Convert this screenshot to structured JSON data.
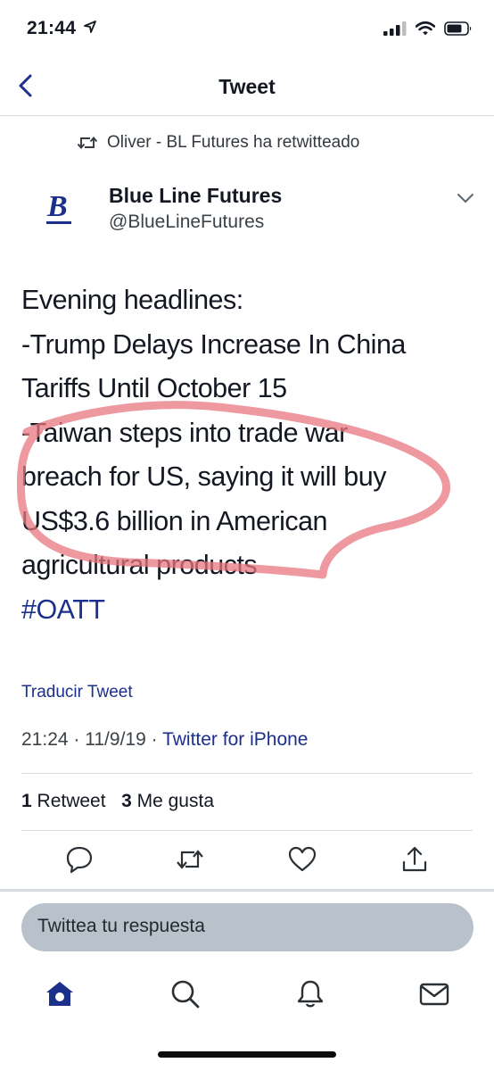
{
  "status_bar": {
    "time": "21:44"
  },
  "nav": {
    "title": "Tweet"
  },
  "retweet_context": "Oliver - BL Futures ha retwitteado",
  "author": {
    "name": "Blue Line Futures",
    "handle": "@BlueLineFutures",
    "avatar_letter": "B"
  },
  "tweet": {
    "lines": [
      "Evening headlines:",
      "-Trump Delays Increase In China",
      "Tariffs Until October 15",
      "-Taiwan steps into trade war",
      "breach for US, saying it will buy",
      "US$3.6 billion in American",
      "agricultural products"
    ],
    "hashtag": "#OATT",
    "translate": "Traducir Tweet",
    "time": "21:24",
    "date": "11/9/19",
    "separator": "·",
    "client": "Twitter for iPhone"
  },
  "stats": {
    "retweets": "1",
    "retweets_label": "Retweet",
    "likes": "3",
    "likes_label": "Me gusta"
  },
  "reply": {
    "placeholder": "Twittea tu respuesta"
  },
  "icons": {
    "actions": [
      "reply-icon",
      "retweet-icon",
      "like-icon",
      "share-icon"
    ],
    "tabs": [
      "home-icon",
      "search-icon",
      "notifications-icon",
      "messages-icon"
    ]
  },
  "colors": {
    "accent": "#1b2f8b",
    "annotation": "#e8757f",
    "reply_box": "#b9c2ca"
  }
}
